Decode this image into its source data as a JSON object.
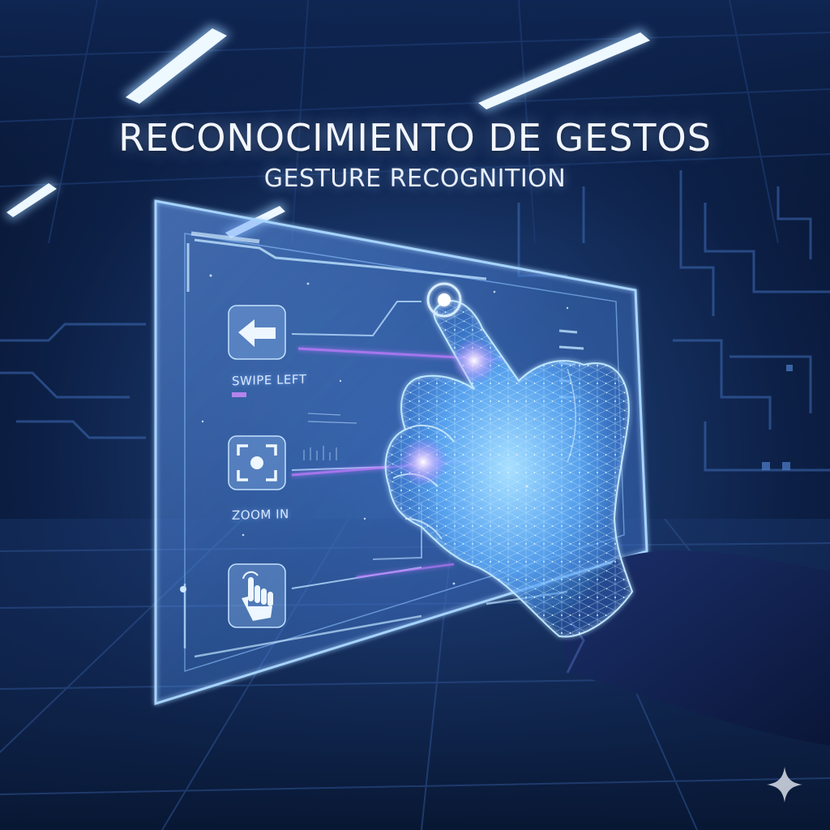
{
  "headline": {
    "title": "RECONOCIMIENTO DE GESTOS",
    "subtitle": "GESTURE RECOGNITION"
  },
  "panel": {
    "gestures": [
      {
        "label": "SWIPE LEFT",
        "icon": "arrow-left-icon"
      },
      {
        "label": "ZOOM IN",
        "icon": "zoom-focus-icon"
      },
      {
        "label": "",
        "icon": "tap-hand-icon"
      }
    ]
  },
  "colors": {
    "background": "#0c1f45",
    "glow": "#7fc4ff",
    "accent_purple": "#c07bff",
    "text": "#f2f6ff"
  },
  "watermark_icon": "sparkle-icon"
}
